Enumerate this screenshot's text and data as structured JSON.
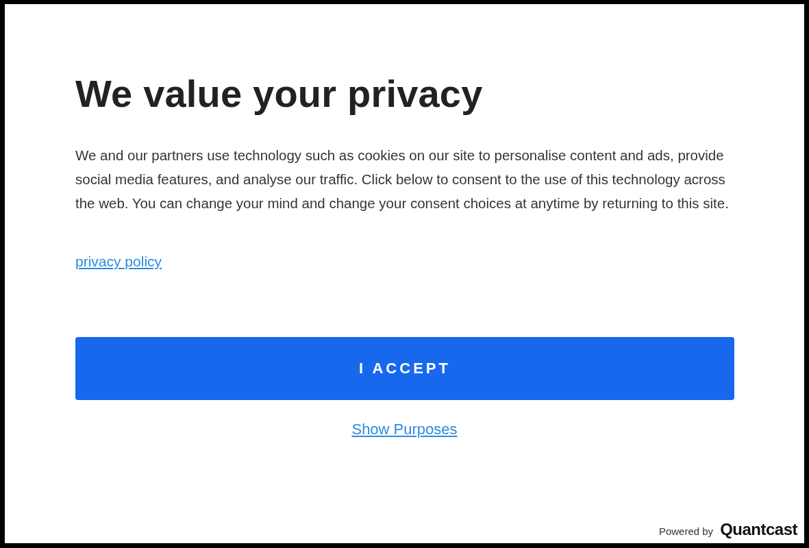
{
  "dialog": {
    "title": "We value your privacy",
    "body": "We and our partners use technology such as cookies on our site to personalise content and ads, provide social media features, and analyse our traffic. Click below to consent to the use of this technology across the web. You can change your mind and change your consent choices at anytime by returning to this site.",
    "privacy_link": "privacy policy",
    "accept_button": "I ACCEPT",
    "purposes_link": "Show Purposes",
    "footer": {
      "powered_by": "Powered by",
      "brand": "Quantcast"
    }
  }
}
